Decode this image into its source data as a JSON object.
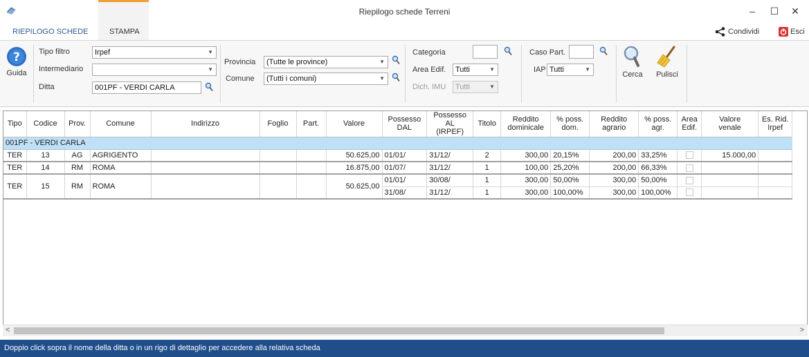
{
  "window": {
    "title": "Riepilogo schede Terreni",
    "minimize": "–",
    "maximize": "☐",
    "close": "✕"
  },
  "tabs": [
    {
      "label": "RIEPILOGO SCHEDE"
    },
    {
      "label": "STAMPA"
    }
  ],
  "share": {
    "label": "Condividi"
  },
  "exit": {
    "label": "Esci"
  },
  "ribbon": {
    "guida": "Guida",
    "tipo_filtro_label": "Tipo filtro",
    "tipo_filtro_value": "Irpef",
    "intermediario_label": "Intermediario",
    "intermediario_value": "",
    "ditta_label": "Ditta",
    "ditta_value": "001PF - VERDI CARLA",
    "provincia_label": "Provincia",
    "provincia_value": "(Tutte le province)",
    "comune_label": "Comune",
    "comune_value": "(Tutti i comuni)",
    "categoria_label": "Categoria",
    "categoria_value": "",
    "area_edif_label": "Area Edif.",
    "area_edif_value": "Tutti",
    "dich_imu_label": "Dich. IMU",
    "dich_imu_value": "Tutti",
    "caso_part_label": "Caso Part.",
    "caso_part_value": "",
    "iap_label": "IAP",
    "iap_value": "Tutti",
    "cerca": "Cerca",
    "pulisci": "Pulisci"
  },
  "grid": {
    "columns": [
      "Tipo",
      "Codice",
      "Prov.",
      "Comune",
      "Indirizzo",
      "Foglio",
      "Part.",
      "Valore",
      "Possesso DAL",
      "Possesso AL (IRPEF)",
      "Titolo",
      "Reddito dominicale",
      "% poss. dom.",
      "Reddito agrario",
      "% poss. agr.",
      "Area Edif.",
      "Valore venale",
      "Es. Rid. Irpef"
    ],
    "group": "001PF - VERDI CARLA",
    "rows": [
      {
        "tipo": "TER",
        "codice": "13",
        "prov": "AG",
        "comune": "AGRIGENTO",
        "valore": "50.625,00",
        "dal": "01/01/",
        "al": "31/12/",
        "titolo": "2",
        "red_dom": "300,00",
        "poss_dom": "20,15%",
        "red_agr": "200,00",
        "poss_agr": "33,25%",
        "valore_venale": "15.000,00"
      },
      {
        "tipo": "TER",
        "codice": "14",
        "prov": "RM",
        "comune": "ROMA",
        "valore": "16.875,00",
        "dal": "01/07/",
        "al": "31/12/",
        "titolo": "1",
        "red_dom": "100,00",
        "poss_dom": "25,20%",
        "red_agr": "200,00",
        "poss_agr": "66,33%",
        "valore_venale": ""
      },
      {
        "tipo": "TER",
        "codice": "15",
        "prov": "RM",
        "comune": "ROMA",
        "valore": "50.625,00",
        "sub": [
          {
            "dal": "01/01/",
            "al": "30/08/",
            "titolo": "1",
            "red_dom": "300,00",
            "poss_dom": "50,00%",
            "red_agr": "300,00",
            "poss_agr": "50,00%"
          },
          {
            "dal": "31/08/",
            "al": "31/12/",
            "titolo": "1",
            "red_dom": "300,00",
            "poss_dom": "100,00%",
            "red_agr": "300,00",
            "poss_agr": "100,00%"
          }
        ]
      }
    ]
  },
  "status": "Doppio click sopra il nome della ditta o in un rigo di dettaglio per accedere alla relativa scheda",
  "icons": {
    "app": "app-icon",
    "help": "help-icon",
    "search": "search-icon",
    "clean": "broom-icon",
    "share": "share-icon",
    "exit": "exit-icon",
    "lookup": "magnifier-icon"
  },
  "colors": {
    "status_bar": "#1f4e8a",
    "group_row": "#bfe0f6",
    "tab_active": "#2b5797",
    "help_icon": "#2f6fc0"
  }
}
